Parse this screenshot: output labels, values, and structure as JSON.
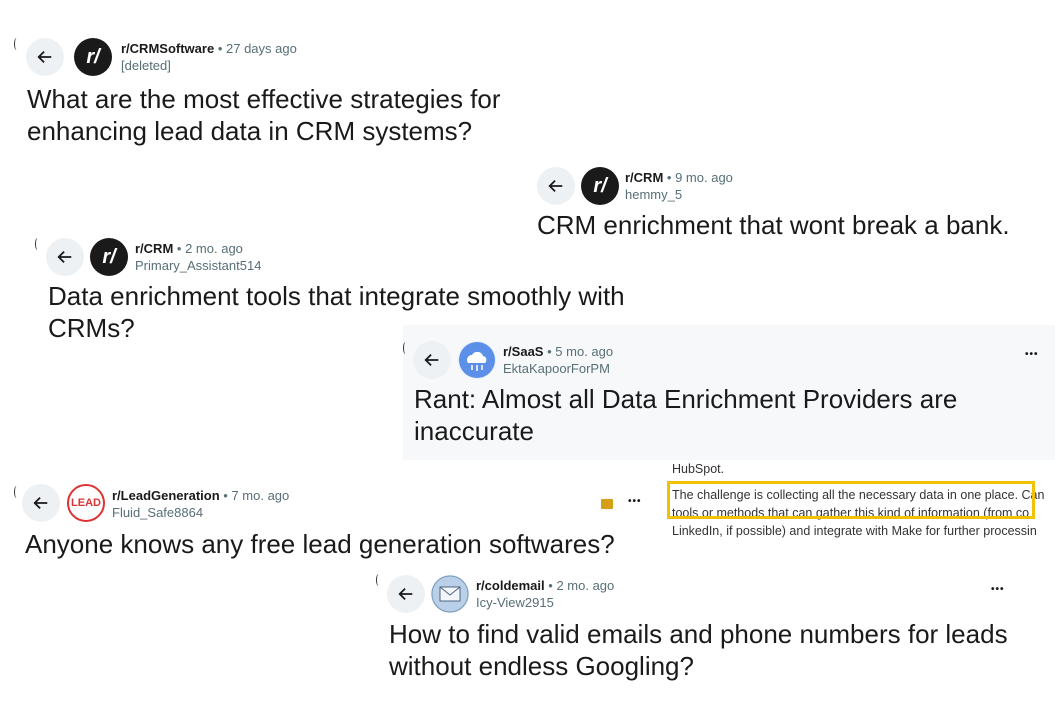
{
  "posts": [
    {
      "subreddit": "r/CRMSoftware",
      "age": "27 days ago",
      "user": "[deleted]",
      "title": "What are the most effective strategies for enhancing lead data in CRM systems?"
    },
    {
      "subreddit": "r/CRM",
      "age": "9 mo. ago",
      "user": "hemmy_5",
      "title": "CRM enrichment that wont break a bank."
    },
    {
      "subreddit": "r/CRM",
      "age": "2 mo. ago",
      "user": "Primary_Assistant514",
      "title": "Data enrichment tools that integrate smoothly with CRMs?"
    },
    {
      "subreddit": "r/SaaS",
      "age": "5 mo. ago",
      "user": "EktaKapoorForPM",
      "title": "Rant: Almost all Data Enrichment Providers are inaccurate"
    },
    {
      "subreddit": "r/LeadGeneration",
      "age": "7 mo. ago",
      "user": "Fluid_Safe8864",
      "title": "Anyone knows any free lead generation softwares?"
    },
    {
      "subreddit": "r/coldemail",
      "age": "2 mo. ago",
      "user": "Icy-View2915",
      "title": "How to find valid emails and phone numbers for leads without endless Googling?"
    }
  ],
  "separator": "•",
  "more_label": "•••",
  "lead_logo_text": "LEAD",
  "snippet": {
    "line0": "HubSpot.",
    "highlight": "The challenge is collecting all the necessary data in one place.",
    "line1_rest": " Can",
    "line2": "tools or methods that can gather this kind of information (from co",
    "line3": "LinkedIn, if possible) and integrate with Make for further processin"
  },
  "colors": {
    "highlight": "#f2c200",
    "avatar_dark": "#1a1a1b",
    "saas_blue": "#5b8fe8",
    "lead_red": "#d33"
  }
}
